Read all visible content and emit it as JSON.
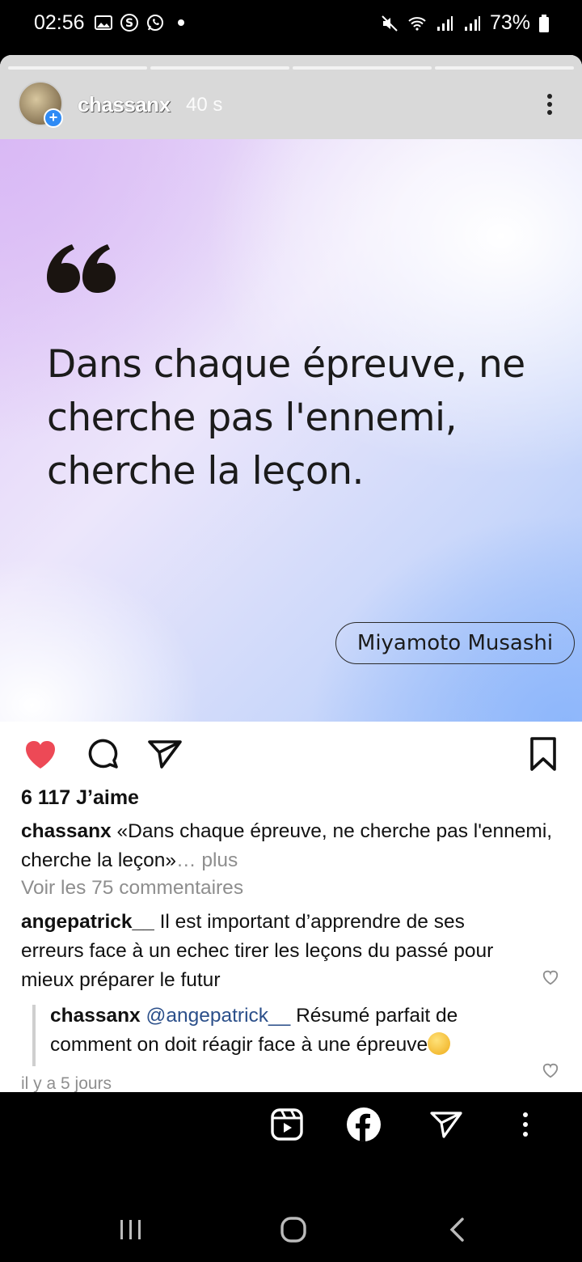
{
  "status_bar": {
    "time": "02:56",
    "battery": "73%",
    "left_icons": [
      "gallery-icon",
      "s-app-icon",
      "whatsapp-icon"
    ],
    "right_icons": [
      "mute-icon",
      "wifi-icon",
      "signal-icon",
      "signal-icon",
      "battery-icon"
    ]
  },
  "story": {
    "progress_segments": 4,
    "username": "chassanx",
    "elapsed": "40 s",
    "quote": {
      "text": "Dans chaque épreuve, ne cherche pas l'ennemi, cherche la leçon.",
      "author": "Miyamoto Musashi"
    }
  },
  "post": {
    "likes": "6 117 J’aime",
    "caption": {
      "user": "chassanx",
      "text": "«Dans chaque épreuve, ne cherche pas l'ennemi, cherche la leçon»",
      "more": "… plus"
    },
    "view_comments": "Voir les 75 commentaires",
    "comment": {
      "user": "angepatrick__",
      "text": "Il est important d’apprendre de ses erreurs face à un echec tirer les leçons du passé pour mieux préparer le futur"
    },
    "reply": {
      "user": "chassanx",
      "mention": "@angepatrick__",
      "text": "Résumé parfait de comment on doit réagir face à une épreuve"
    },
    "timestamp": "il y a 5 jours"
  },
  "colors": {
    "like_red": "#ed4956",
    "mention_blue": "#2b4f8a",
    "muted_gray": "#8e8e8e"
  }
}
